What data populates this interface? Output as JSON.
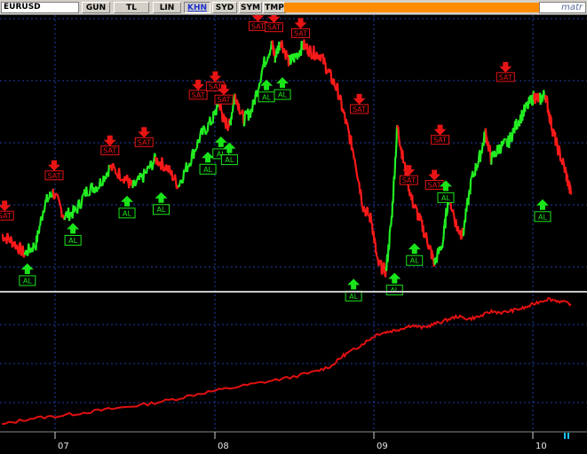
{
  "toolbar": {
    "symbol": "EURUSD",
    "buttons": [
      "GUN",
      "TL",
      "LIN",
      "KHN",
      "SYD",
      "SYM",
      "TMP"
    ],
    "active_button": "KHN",
    "brand": "matr"
  },
  "colors": {
    "background": "#000000",
    "grid": "#1f3fa8",
    "up": "#22ee22",
    "down": "#ff1a1a",
    "equity": "#e01010",
    "buy": "#19e519",
    "sell": "#e81414",
    "separator": "#c8c8c8"
  },
  "icons": {
    "buy": "green-up-arrow-icon",
    "sell": "red-down-arrow-icon"
  },
  "chart_data": [
    {
      "type": "line",
      "title": "",
      "x_ticks": [
        "07",
        "08",
        "09",
        "10"
      ],
      "series": [
        {
          "values": [
            [
              0.0,
              0.36
            ],
            [
              0.02,
              0.3
            ],
            [
              0.04,
              0.2
            ],
            [
              0.06,
              0.28
            ],
            [
              0.075,
              0.62
            ],
            [
              0.09,
              0.72
            ],
            [
              0.11,
              0.52
            ],
            [
              0.13,
              0.56
            ],
            [
              0.15,
              0.74
            ],
            [
              0.17,
              0.78
            ],
            [
              0.19,
              0.93
            ],
            [
              0.215,
              0.85
            ],
            [
              0.23,
              0.76
            ],
            [
              0.25,
              0.86
            ],
            [
              0.27,
              1.0
            ],
            [
              0.29,
              0.93
            ],
            [
              0.31,
              0.78
            ],
            [
              0.33,
              0.98
            ],
            [
              0.35,
              1.2
            ],
            [
              0.37,
              1.33
            ],
            [
              0.382,
              1.48
            ],
            [
              0.39,
              1.32
            ],
            [
              0.4,
              1.28
            ],
            [
              0.41,
              1.55
            ],
            [
              0.425,
              1.33
            ],
            [
              0.44,
              1.42
            ],
            [
              0.46,
              1.8
            ],
            [
              0.475,
              1.97
            ],
            [
              0.48,
              1.86
            ],
            [
              0.49,
              2.0
            ],
            [
              0.505,
              1.82
            ],
            [
              0.515,
              1.86
            ],
            [
              0.53,
              1.96
            ],
            [
              0.545,
              1.9
            ],
            [
              0.56,
              1.88
            ],
            [
              0.575,
              1.72
            ],
            [
              0.59,
              1.58
            ],
            [
              0.605,
              1.3
            ],
            [
              0.62,
              1.02
            ],
            [
              0.635,
              0.6
            ],
            [
              0.65,
              0.48
            ],
            [
              0.66,
              0.12
            ],
            [
              0.675,
              0.05
            ],
            [
              0.685,
              0.5
            ],
            [
              0.695,
              1.28
            ],
            [
              0.705,
              1.0
            ],
            [
              0.72,
              0.66
            ],
            [
              0.735,
              0.48
            ],
            [
              0.75,
              0.28
            ],
            [
              0.76,
              0.12
            ],
            [
              0.775,
              0.3
            ],
            [
              0.785,
              0.7
            ],
            [
              0.8,
              0.42
            ],
            [
              0.81,
              0.36
            ],
            [
              0.825,
              0.82
            ],
            [
              0.84,
              1.02
            ],
            [
              0.85,
              1.22
            ],
            [
              0.86,
              1.0
            ],
            [
              0.875,
              1.1
            ],
            [
              0.89,
              1.14
            ],
            [
              0.905,
              1.3
            ],
            [
              0.92,
              1.42
            ],
            [
              0.935,
              1.53
            ],
            [
              0.945,
              1.5
            ],
            [
              0.955,
              1.55
            ],
            [
              0.965,
              1.3
            ],
            [
              0.975,
              1.12
            ],
            [
              0.99,
              0.9
            ],
            [
              1.0,
              0.7
            ]
          ]
        }
      ],
      "signals": [
        {
          "label": "SAT",
          "x": 0.005,
          "y": 0.38,
          "side": "sell"
        },
        {
          "label": "AL",
          "x": 0.045,
          "y": 0.18,
          "side": "buy"
        },
        {
          "label": "SAT",
          "x": 0.092,
          "y": 0.72,
          "side": "sell"
        },
        {
          "label": "AL",
          "x": 0.125,
          "y": 0.52,
          "side": "buy"
        },
        {
          "label": "SAT",
          "x": 0.19,
          "y": 0.93,
          "side": "sell"
        },
        {
          "label": "AL",
          "x": 0.22,
          "y": 0.75,
          "side": "buy"
        },
        {
          "label": "SAT",
          "x": 0.25,
          "y": 1.0,
          "side": "sell"
        },
        {
          "label": "AL",
          "x": 0.28,
          "y": 0.78,
          "side": "buy"
        },
        {
          "label": "SAT",
          "x": 0.345,
          "y": 1.4,
          "side": "sell"
        },
        {
          "label": "AL",
          "x": 0.362,
          "y": 1.12,
          "side": "buy"
        },
        {
          "label": "SAT",
          "x": 0.375,
          "y": 1.47,
          "side": "sell"
        },
        {
          "label": "AL",
          "x": 0.385,
          "y": 1.25,
          "side": "buy"
        },
        {
          "label": "SAT",
          "x": 0.39,
          "y": 1.36,
          "side": "sell"
        },
        {
          "label": "AL",
          "x": 0.4,
          "y": 1.2,
          "side": "buy"
        },
        {
          "label": "SAT",
          "x": 0.45,
          "y": 1.98,
          "side": "sell"
        },
        {
          "label": "AL",
          "x": 0.465,
          "y": 1.73,
          "side": "buy"
        },
        {
          "label": "SAT",
          "x": 0.478,
          "y": 1.97,
          "side": "sell"
        },
        {
          "label": "AL",
          "x": 0.493,
          "y": 1.75,
          "side": "buy"
        },
        {
          "label": "SAT",
          "x": 0.525,
          "y": 1.92,
          "side": "sell"
        },
        {
          "label": "SAT",
          "x": 0.628,
          "y": 1.28,
          "side": "sell"
        },
        {
          "label": "AL",
          "x": 0.618,
          "y": 0.05,
          "side": "buy"
        },
        {
          "label": "SAT",
          "x": 0.715,
          "y": 0.68,
          "side": "sell"
        },
        {
          "label": "AL",
          "x": 0.69,
          "y": 0.1,
          "side": "buy"
        },
        {
          "label": "SAT",
          "x": 0.76,
          "y": 0.64,
          "side": "sell"
        },
        {
          "label": "AL",
          "x": 0.725,
          "y": 0.35,
          "side": "buy"
        },
        {
          "label": "SAT",
          "x": 0.77,
          "y": 1.02,
          "side": "sell"
        },
        {
          "label": "AL",
          "x": 0.78,
          "y": 0.88,
          "side": "buy"
        },
        {
          "label": "SAT",
          "x": 0.885,
          "y": 1.55,
          "side": "sell"
        },
        {
          "label": "AL",
          "x": 0.95,
          "y": 0.72,
          "side": "buy"
        }
      ]
    },
    {
      "type": "line",
      "title": "",
      "series": [
        {
          "values": [
            [
              0.0,
              0.0
            ],
            [
              0.05,
              0.05
            ],
            [
              0.1,
              0.07
            ],
            [
              0.15,
              0.1
            ],
            [
              0.2,
              0.13
            ],
            [
              0.25,
              0.16
            ],
            [
              0.3,
              0.2
            ],
            [
              0.35,
              0.25
            ],
            [
              0.4,
              0.29
            ],
            [
              0.45,
              0.33
            ],
            [
              0.5,
              0.37
            ],
            [
              0.55,
              0.42
            ],
            [
              0.58,
              0.47
            ],
            [
              0.6,
              0.55
            ],
            [
              0.62,
              0.6
            ],
            [
              0.64,
              0.66
            ],
            [
              0.66,
              0.72
            ],
            [
              0.68,
              0.74
            ],
            [
              0.7,
              0.76
            ],
            [
              0.72,
              0.79
            ],
            [
              0.74,
              0.77
            ],
            [
              0.76,
              0.8
            ],
            [
              0.78,
              0.83
            ],
            [
              0.8,
              0.86
            ],
            [
              0.82,
              0.84
            ],
            [
              0.84,
              0.86
            ],
            [
              0.86,
              0.9
            ],
            [
              0.88,
              0.89
            ],
            [
              0.9,
              0.91
            ],
            [
              0.92,
              0.93
            ],
            [
              0.94,
              0.97
            ],
            [
              0.96,
              1.0
            ],
            [
              0.98,
              0.98
            ],
            [
              1.0,
              0.96
            ]
          ]
        }
      ]
    }
  ]
}
